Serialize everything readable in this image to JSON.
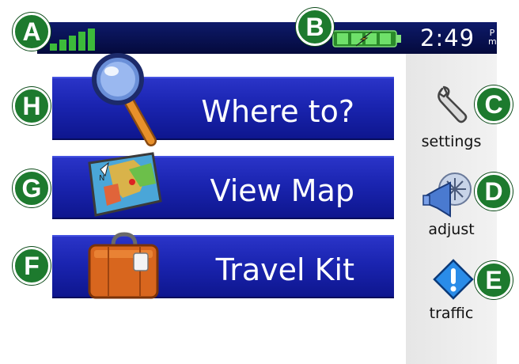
{
  "status_bar": {
    "signal_icon": "signal-bars-icon",
    "battery_icon": "battery-charging-icon",
    "time": "2:49",
    "am_pm_top": "P",
    "am_pm_bottom": "m"
  },
  "main_menu": [
    {
      "label": "Where to?",
      "icon": "magnifying-glass-icon"
    },
    {
      "label": "View Map",
      "icon": "map-icon"
    },
    {
      "label": "Travel Kit",
      "icon": "suitcase-icon"
    }
  ],
  "side_menu": [
    {
      "label": "settings",
      "icon": "wrench-icon"
    },
    {
      "label": "adjust",
      "icon": "speaker-icon"
    },
    {
      "label": "traffic",
      "icon": "traffic-warning-icon"
    }
  ],
  "callouts": {
    "A": "A",
    "B": "B",
    "C": "C",
    "D": "D",
    "E": "E",
    "F": "F",
    "G": "G",
    "H": "H"
  },
  "colors": {
    "status_bar": "#040a3c",
    "button_blue": "#1a24b0",
    "callout_green": "#1d7a2e",
    "sidebar_gray": "#ececec"
  }
}
